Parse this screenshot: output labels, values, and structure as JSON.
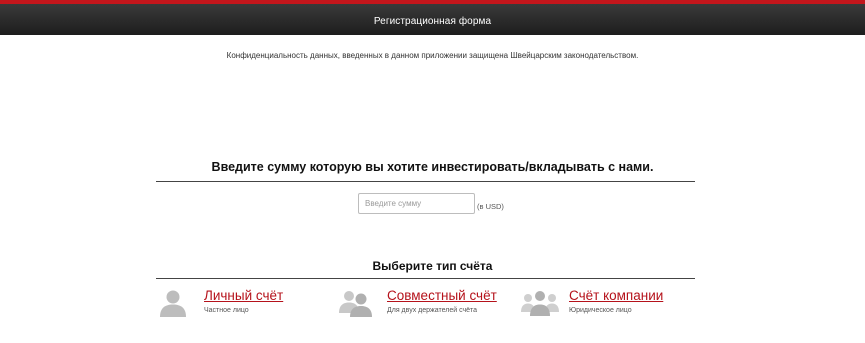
{
  "header": {
    "title": "Регистрационная форма"
  },
  "privacy_note": "Конфиденциальность данных, введенных в данном приложении защищена Швейцарским законодательством.",
  "invest": {
    "heading": "Введите сумму которую вы хотите инвестировать/вкладывать с нами.",
    "amount_placeholder": "Введите сумму",
    "amount_value": "",
    "unit": "(в USD)"
  },
  "account_type": {
    "heading": "Выберите тип счёта",
    "options": [
      {
        "title": "Личный счёт",
        "subtitle": "Частное лицо",
        "icon": "single-person-icon"
      },
      {
        "title": "Совместный счёт",
        "subtitle": "Для двух держателей счёта",
        "icon": "two-people-icon"
      },
      {
        "title": "Счёт компании",
        "subtitle": "Юридическое лицо",
        "icon": "group-people-icon"
      }
    ]
  },
  "colors": {
    "accent": "#c4161c",
    "link": "#b5121b",
    "header_bg": "#2a2a2a",
    "icon": "#bdbdbd"
  }
}
